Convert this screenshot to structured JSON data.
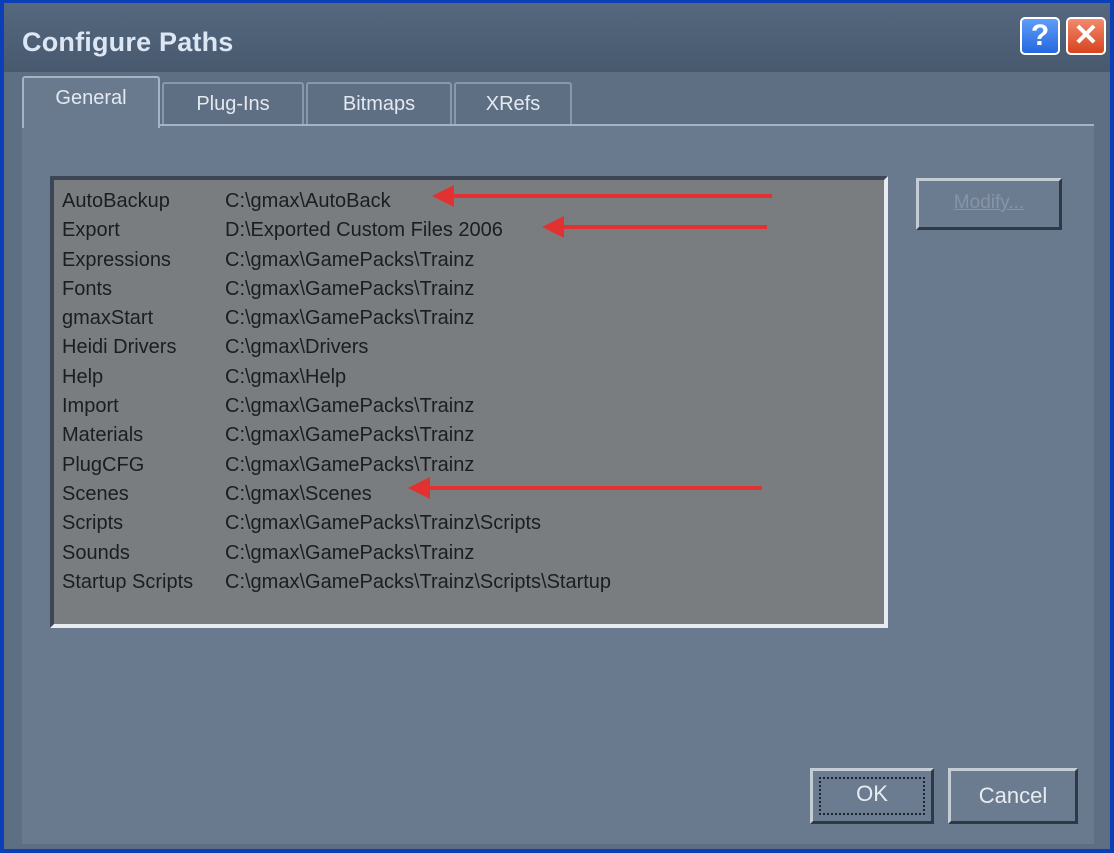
{
  "window": {
    "title": "Configure Paths"
  },
  "titlebar_buttons": {
    "help_label": "?",
    "close_label": "✕"
  },
  "tabs": [
    {
      "label": "General",
      "active": true
    },
    {
      "label": "Plug-Ins",
      "active": false
    },
    {
      "label": "Bitmaps",
      "active": false
    },
    {
      "label": "XRefs",
      "active": false
    }
  ],
  "paths": [
    {
      "name": "AutoBackup",
      "path": "C:\\gmax\\AutoBack"
    },
    {
      "name": "Export",
      "path": "D:\\Exported Custom Files 2006"
    },
    {
      "name": "Expressions",
      "path": "C:\\gmax\\GamePacks\\Trainz"
    },
    {
      "name": "Fonts",
      "path": "C:\\gmax\\GamePacks\\Trainz"
    },
    {
      "name": "gmaxStart",
      "path": "C:\\gmax\\GamePacks\\Trainz"
    },
    {
      "name": "Heidi Drivers",
      "path": "C:\\gmax\\Drivers"
    },
    {
      "name": "Help",
      "path": "C:\\gmax\\Help"
    },
    {
      "name": "Import",
      "path": "C:\\gmax\\GamePacks\\Trainz"
    },
    {
      "name": "Materials",
      "path": "C:\\gmax\\GamePacks\\Trainz"
    },
    {
      "name": "PlugCFG",
      "path": "C:\\gmax\\GamePacks\\Trainz"
    },
    {
      "name": "Scenes",
      "path": "C:\\gmax\\Scenes"
    },
    {
      "name": "Scripts",
      "path": "C:\\gmax\\GamePacks\\Trainz\\Scripts"
    },
    {
      "name": "Sounds",
      "path": "C:\\gmax\\GamePacks\\Trainz"
    },
    {
      "name": "Startup Scripts",
      "path": "C:\\gmax\\GamePacks\\Trainz\\Scripts\\Startup"
    }
  ],
  "buttons": {
    "modify": "Modify...",
    "ok": "OK",
    "cancel": "Cancel"
  },
  "annotations": {
    "arrow_color": "#e23131"
  }
}
